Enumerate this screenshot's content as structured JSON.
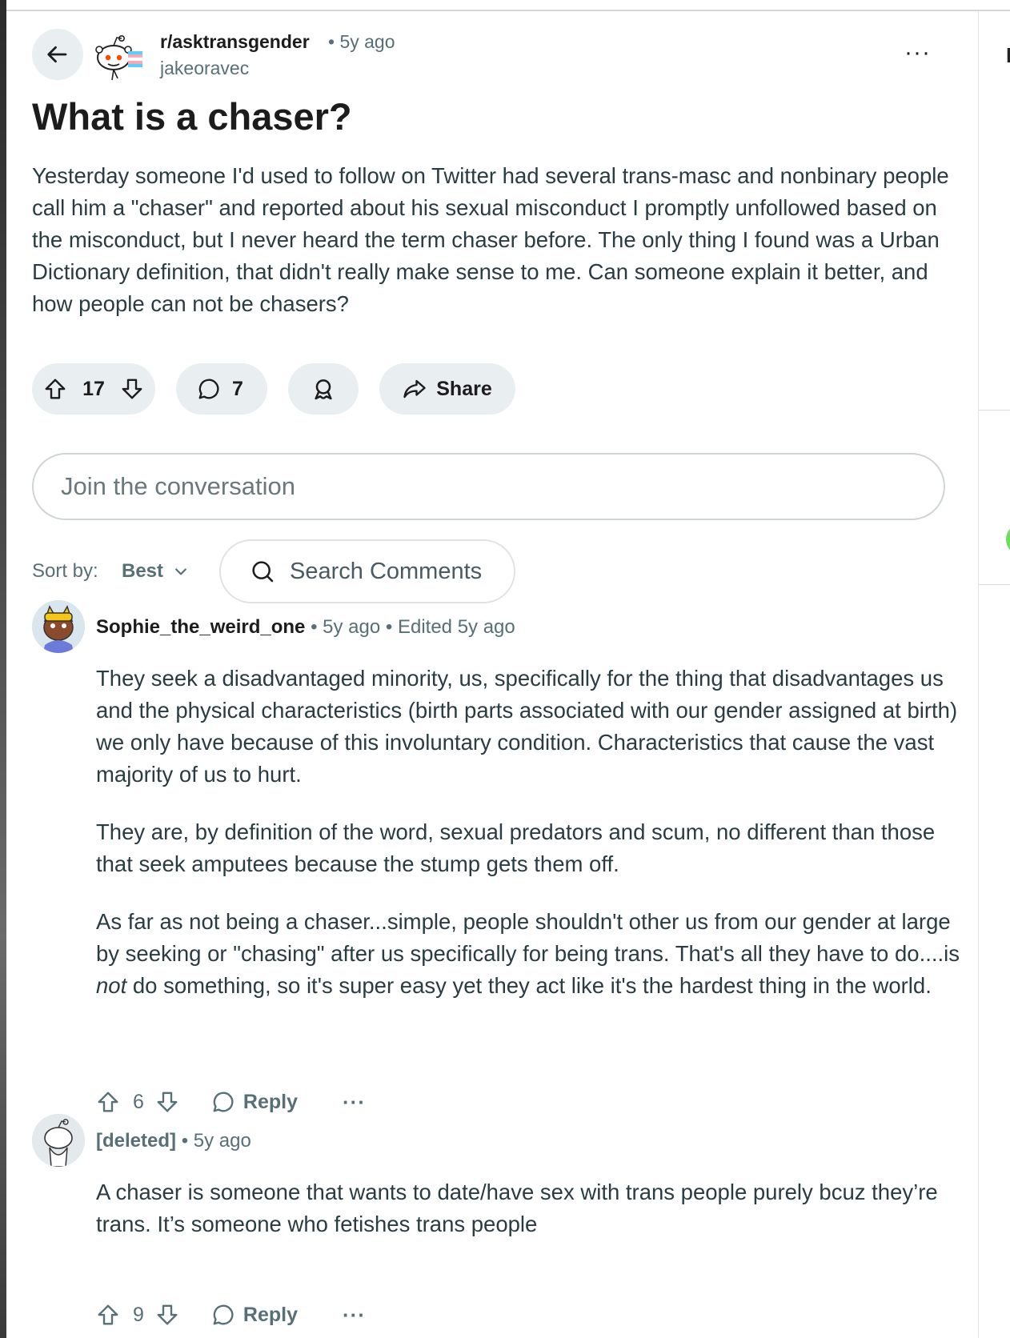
{
  "post": {
    "subreddit": "r/asktransgender",
    "age": "5y ago",
    "author": "jakeoravec",
    "title": "What is a chaser?",
    "body": "Yesterday someone I'd used to follow on Twitter had several trans-masc and nonbinary people call him a \"chaser\" and reported about his sexual misconduct I promptly unfollowed based on the misconduct, but I never heard the term chaser before. The only thing I found was a Urban Dictionary definition, that didn't really make sense to me. Can someone explain it better, and how people can not be chasers?",
    "score": "17",
    "comment_count": "7",
    "share_label": "Share",
    "overflow": "···"
  },
  "join": {
    "placeholder": "Join the conversation"
  },
  "sort": {
    "label": "Sort by:",
    "value": "Best"
  },
  "search_comments": {
    "placeholder": "Search Comments"
  },
  "comments": [
    {
      "user": "Sophie_the_weird_one",
      "age": "5y ago",
      "edited": "Edited 5y ago",
      "paragraphs": [
        "They seek a disadvantaged minority, us, specifically for the thing that disadvantages us and the physical characteristics (birth parts associated with our gender assigned at birth) we only have because of this involuntary condition. Characteristics that cause the vast majority of us to hurt.",
        "They are, by definition of the word, sexual predators and scum, no different than those that seek amputees because the stump gets them off."
      ],
      "p3_before": "As far as not being a chaser...simple, people shouldn't other us from our gender at large by seeking or \"chasing\" after us specifically for being trans. That's all they have to do....is ",
      "p3_em": "not",
      "p3_after": " do something, so it's super easy yet they act like it's the hardest thing in the world.",
      "score": "6",
      "reply_label": "Reply",
      "more": "···"
    },
    {
      "user": "[deleted]",
      "age": "5y ago",
      "body": "A chaser is someone that wants to date/have sex with trans people purely bcuz they’re trans. It’s someone who fetishes trans people",
      "score": "9",
      "reply_label": "Reply",
      "more": "···"
    }
  ],
  "sep": "•",
  "colors": {
    "pill_bg": "#e9eef0",
    "meta": "#576f76",
    "body": "#2a3c42"
  },
  "icons": [
    "back-arrow-icon",
    "subreddit-avatar-icon",
    "upvote-icon",
    "downvote-icon",
    "comment-icon",
    "award-icon",
    "share-icon",
    "search-icon",
    "chevron-down-icon"
  ]
}
